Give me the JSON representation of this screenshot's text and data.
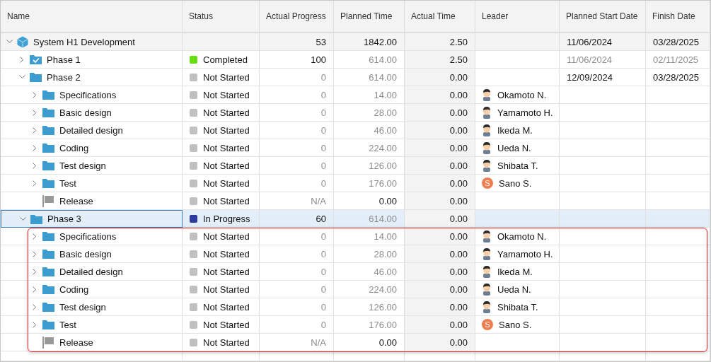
{
  "columns": [
    "Name",
    "Status",
    "Actual Progress",
    "Planned Time",
    "Actual Time",
    "Leader",
    "Planned Start Date",
    "Finish Date"
  ],
  "rows": [
    {
      "name": "System H1 Development",
      "kind": "project",
      "expanded": true,
      "selected": false,
      "progress": "53",
      "planned_time": "1842.00",
      "actual_time": "2.50",
      "start_date": "11/06/2024",
      "finish_date": "03/28/2025",
      "children": [
        {
          "name": "Phase 1",
          "kind": "done-phase",
          "expanded": false,
          "selected": false,
          "status": {
            "label": "Completed",
            "color": "#66dd11"
          },
          "progress": "100",
          "planned_time": "614.00",
          "planned_dim": true,
          "actual_time": "2.50",
          "start_date": "11/06/2024",
          "finish_date": "02/11/2025",
          "dates_dim": true
        },
        {
          "name": "Phase 2",
          "kind": "folder",
          "expanded": true,
          "selected": false,
          "status": {
            "label": "Not Started",
            "color": "#c0c0c0"
          },
          "progress": "0",
          "progress_dim": true,
          "planned_time": "614.00",
          "planned_dim": true,
          "actual_time": "0.00",
          "start_date": "12/09/2024",
          "finish_date": "03/28/2025",
          "children": [
            {
              "name": "Specifications",
              "kind": "folder",
              "expanded": false,
              "selected": false,
              "status": {
                "label": "Not Started",
                "color": "#c0c0c0"
              },
              "progress": "0",
              "progress_dim": true,
              "planned_time": "14.00",
              "planned_dim": true,
              "actual_time": "0.00",
              "leader": {
                "name": "Okamoto N.",
                "kind": "figure"
              }
            },
            {
              "name": "Basic design",
              "kind": "folder",
              "expanded": false,
              "selected": false,
              "status": {
                "label": "Not Started",
                "color": "#c0c0c0"
              },
              "progress": "0",
              "progress_dim": true,
              "planned_time": "28.00",
              "planned_dim": true,
              "actual_time": "0.00",
              "leader": {
                "name": "Yamamoto H.",
                "kind": "figure"
              }
            },
            {
              "name": "Detailed design",
              "kind": "folder",
              "expanded": false,
              "selected": false,
              "status": {
                "label": "Not Started",
                "color": "#c0c0c0"
              },
              "progress": "0",
              "progress_dim": true,
              "planned_time": "46.00",
              "planned_dim": true,
              "actual_time": "0.00",
              "leader": {
                "name": "Ikeda M.",
                "kind": "figure"
              }
            },
            {
              "name": "Coding",
              "kind": "folder",
              "expanded": false,
              "selected": false,
              "status": {
                "label": "Not Started",
                "color": "#c0c0c0"
              },
              "progress": "0",
              "progress_dim": true,
              "planned_time": "224.00",
              "planned_dim": true,
              "actual_time": "0.00",
              "leader": {
                "name": "Ueda N.",
                "kind": "figure"
              }
            },
            {
              "name": "Test design",
              "kind": "folder",
              "expanded": false,
              "selected": false,
              "status": {
                "label": "Not Started",
                "color": "#c0c0c0"
              },
              "progress": "0",
              "progress_dim": true,
              "planned_time": "126.00",
              "planned_dim": true,
              "actual_time": "0.00",
              "leader": {
                "name": "Shibata T.",
                "kind": "figure"
              }
            },
            {
              "name": "Test",
              "kind": "folder",
              "expanded": false,
              "selected": false,
              "status": {
                "label": "Not Started",
                "color": "#c0c0c0"
              },
              "progress": "0",
              "progress_dim": true,
              "planned_time": "176.00",
              "planned_dim": true,
              "actual_time": "0.00",
              "leader": {
                "name": "Sano S.",
                "kind": "initial",
                "initial": "S",
                "color": "#ee7d4f"
              }
            },
            {
              "name": "Release",
              "kind": "milestone",
              "selected": false,
              "status": {
                "label": "Not Started",
                "color": "#c0c0c0"
              },
              "progress": "N/A",
              "progress_dim": true,
              "planned_time": "0.00",
              "actual_time": "0.00"
            }
          ]
        },
        {
          "name": "Phase 3",
          "kind": "folder",
          "expanded": true,
          "selected": true,
          "highlight_children": true,
          "status": {
            "label": "In Progress",
            "color": "#2e3a9e"
          },
          "progress": "60",
          "planned_time": "614.00",
          "planned_dim": true,
          "actual_time": "0.00",
          "children": [
            {
              "name": "Specifications",
              "kind": "folder",
              "expanded": false,
              "selected": false,
              "status": {
                "label": "Not Started",
                "color": "#c0c0c0"
              },
              "progress": "0",
              "progress_dim": true,
              "planned_time": "14.00",
              "planned_dim": true,
              "actual_time": "0.00",
              "leader": {
                "name": "Okamoto N.",
                "kind": "figure"
              }
            },
            {
              "name": "Basic design",
              "kind": "folder",
              "expanded": false,
              "selected": false,
              "status": {
                "label": "Not Started",
                "color": "#c0c0c0"
              },
              "progress": "0",
              "progress_dim": true,
              "planned_time": "28.00",
              "planned_dim": true,
              "actual_time": "0.00",
              "leader": {
                "name": "Yamamoto H.",
                "kind": "figure"
              }
            },
            {
              "name": "Detailed design",
              "kind": "folder",
              "expanded": false,
              "selected": false,
              "status": {
                "label": "Not Started",
                "color": "#c0c0c0"
              },
              "progress": "0",
              "progress_dim": true,
              "planned_time": "46.00",
              "planned_dim": true,
              "actual_time": "0.00",
              "leader": {
                "name": "Ikeda M.",
                "kind": "figure"
              }
            },
            {
              "name": "Coding",
              "kind": "folder",
              "expanded": false,
              "selected": false,
              "status": {
                "label": "Not Started",
                "color": "#c0c0c0"
              },
              "progress": "0",
              "progress_dim": true,
              "planned_time": "224.00",
              "planned_dim": true,
              "actual_time": "0.00",
              "leader": {
                "name": "Ueda N.",
                "kind": "figure"
              }
            },
            {
              "name": "Test design",
              "kind": "folder",
              "expanded": false,
              "selected": false,
              "status": {
                "label": "Not Started",
                "color": "#c0c0c0"
              },
              "progress": "0",
              "progress_dim": true,
              "planned_time": "126.00",
              "planned_dim": true,
              "actual_time": "0.00",
              "leader": {
                "name": "Shibata T.",
                "kind": "figure"
              }
            },
            {
              "name": "Test",
              "kind": "folder",
              "expanded": false,
              "selected": false,
              "status": {
                "label": "Not Started",
                "color": "#c0c0c0"
              },
              "progress": "0",
              "progress_dim": true,
              "planned_time": "176.00",
              "planned_dim": true,
              "actual_time": "0.00",
              "leader": {
                "name": "Sano S.",
                "kind": "initial",
                "initial": "S",
                "color": "#ee7d4f"
              }
            },
            {
              "name": "Release",
              "kind": "milestone",
              "selected": false,
              "status": {
                "label": "Not Started",
                "color": "#c0c0c0"
              },
              "progress": "N/A",
              "progress_dim": true,
              "planned_time": "0.00",
              "actual_time": "0.00"
            }
          ]
        }
      ]
    }
  ]
}
